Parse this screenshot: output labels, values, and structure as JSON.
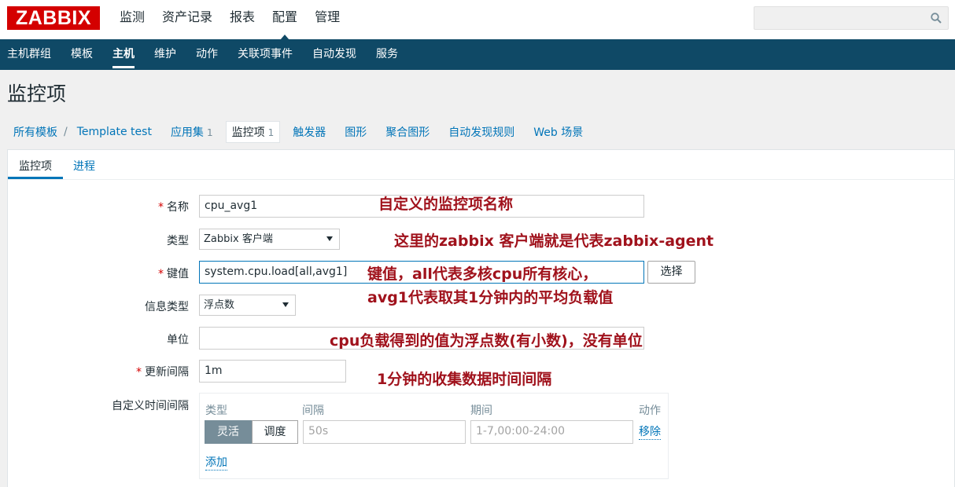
{
  "topbar": {
    "logo": "ZABBIX",
    "nav": [
      "监测",
      "资产记录",
      "报表",
      "配置",
      "管理"
    ],
    "active_nav": "配置",
    "search_placeholder": ""
  },
  "subnav": {
    "items": [
      "主机群组",
      "模板",
      "主机",
      "维护",
      "动作",
      "关联项事件",
      "自动发现",
      "服务"
    ],
    "active": "主机"
  },
  "page_title": "监控项",
  "breadcrumb": {
    "all_templates": "所有模板",
    "separator": "/",
    "template": "Template test",
    "apps_label": "应用集",
    "apps_count": "1",
    "items_label": "监控项",
    "items_count": "1",
    "triggers": "触发器",
    "graphs": "图形",
    "screens": "聚合图形",
    "discovery": "自动发现规则",
    "web": "Web 场景"
  },
  "form_tabs": {
    "item": "监控项",
    "process": "进程"
  },
  "form": {
    "name_label": "名称",
    "name_value": "cpu_avg1",
    "type_label": "类型",
    "type_value": "Zabbix 客户端",
    "key_label": "键值",
    "key_value": "system.cpu.load[all,avg1]",
    "choose_button": "选择",
    "info_type_label": "信息类型",
    "info_type_value": "浮点数",
    "units_label": "单位",
    "units_value": "",
    "update_label": "更新间隔",
    "update_value": "1m",
    "custom_label": "自定义时间间隔",
    "custom": {
      "col_type": "类型",
      "col_interval": "间隔",
      "col_period": "期间",
      "col_action": "动作",
      "flex": "灵活",
      "schedule": "调度",
      "interval_placeholder": "50s",
      "period_placeholder": "1-7,00:00-24:00",
      "remove": "移除",
      "add": "添加"
    }
  },
  "annotations": {
    "name_note": "自定义的监控项名称",
    "type_note": "这里的zabbix 客户端就是代表zabbix-agent",
    "key_note_1": "键值，all代表多核cpu所有核心，",
    "key_note_2": "avg1代表取其1分钟内的平均负载值",
    "units_note": "cpu负载得到的值为浮点数(有小数)，没有单位",
    "update_note": "1分钟的收集数据时间间隔"
  },
  "colors": {
    "logo_red": "#d40000",
    "nav_blue": "#0f4966",
    "link_blue": "#0275b8",
    "annotation_red": "#a0121c"
  }
}
